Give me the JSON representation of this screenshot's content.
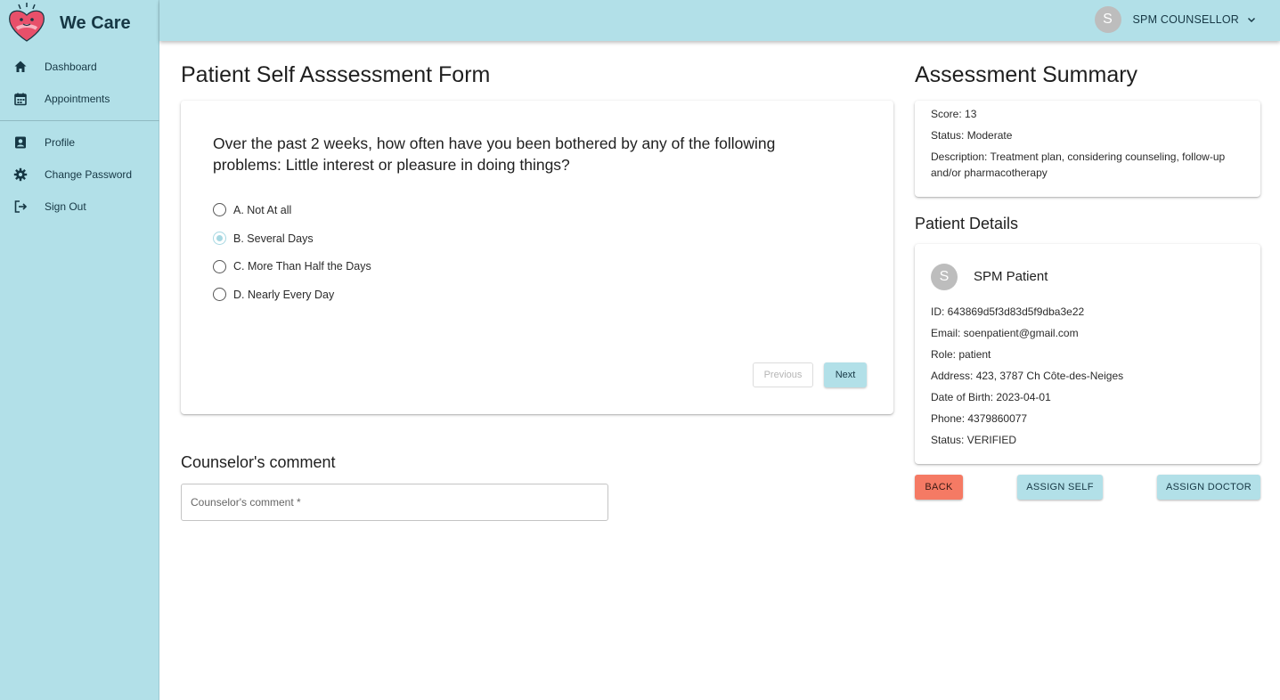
{
  "app": {
    "name": "We Care"
  },
  "sidebar": {
    "items_top": [
      {
        "label": "Dashboard",
        "icon": "home-icon"
      },
      {
        "label": "Appointments",
        "icon": "calendar-icon"
      }
    ],
    "items_bottom": [
      {
        "label": "Profile",
        "icon": "profile-icon"
      },
      {
        "label": "Change Password",
        "icon": "gear-icon"
      },
      {
        "label": "Sign Out",
        "icon": "logout-icon"
      }
    ]
  },
  "topbar": {
    "avatar_initial": "S",
    "user_name": "SPM COUNSELLOR"
  },
  "form": {
    "title": "Patient Self Asssessment Form",
    "question": "Over the past 2 weeks, how often have you been bothered by any of the following problems: Little interest or pleasure in doing things?",
    "options": [
      {
        "label": "A. Not At all",
        "selected": false
      },
      {
        "label": "B. Several Days",
        "selected": true
      },
      {
        "label": "C. More Than Half the Days",
        "selected": false
      },
      {
        "label": "D. Nearly Every Day",
        "selected": false
      }
    ],
    "previous_label": "Previous",
    "next_label": "Next"
  },
  "comment": {
    "title": "Counselor's comment",
    "placeholder": "Counselor's comment *"
  },
  "summary": {
    "title": "Assessment Summary",
    "score": "Score: 13",
    "status": "Status: Moderate",
    "description": "Description: Treatment plan, considering counseling, follow-up and/or pharmacotherapy"
  },
  "patient": {
    "section_title": "Patient Details",
    "avatar_initial": "S",
    "name": "SPM Patient",
    "id": "ID: 643869d5f3d83d5f9dba3e22",
    "email": "Email: soenpatient@gmail.com",
    "role": "Role: patient",
    "address": "Address: 423, 3787 Ch Côte-des-Neiges",
    "dob": "Date of Birth: 2023-04-01",
    "phone": "Phone: 4379860077",
    "status": "Status: VERIFIED"
  },
  "actions": {
    "back": "BACK",
    "assign_self": "ASSIGN SELF",
    "assign_doctor": "ASSIGN DOCTOR"
  },
  "colors": {
    "accent": "#b2e0e8",
    "back_button": "#f57a64",
    "logo_heart": "#e8506a"
  }
}
